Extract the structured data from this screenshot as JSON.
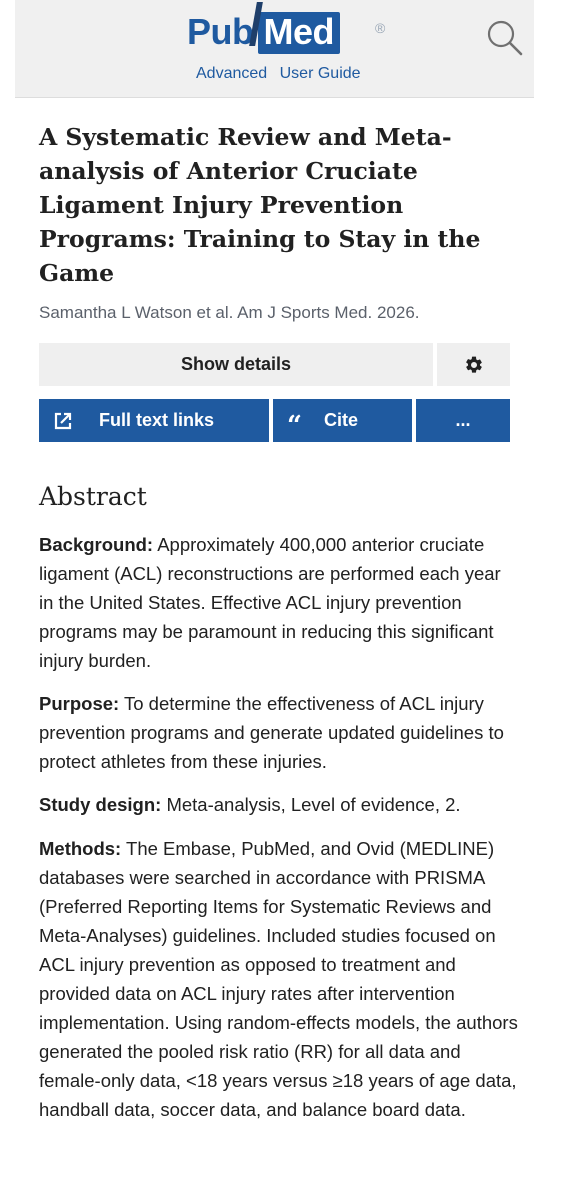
{
  "header": {
    "logo_pub": "Pub",
    "logo_med": "Med",
    "logo_reg": "®",
    "advanced_label": "Advanced",
    "user_guide_label": "User Guide",
    "search_icon": "magnifier-icon"
  },
  "article": {
    "title": "A Systematic Review and Meta-analysis of Anterior Cruciate Ligament Injury Prevention Programs: Training to Stay in the Game",
    "citation": "Samantha L Watson et al. Am J Sports Med. 2026."
  },
  "actions": {
    "show_details": "Show details",
    "full_text_links": "Full text links",
    "cite": "Cite",
    "cite_glyph": "“",
    "more": "...",
    "gear_icon": "gear-icon",
    "external_link_icon": "external-link-icon"
  },
  "abstract": {
    "heading": "Abstract",
    "sections": [
      {
        "label": "Background:",
        "text": "Approximately 400,000 anterior cruciate ligament (ACL) reconstructions are performed each year in the United States. Effective ACL injury prevention programs may be paramount in reducing this significant injury burden."
      },
      {
        "label": "Purpose:",
        "text": "To determine the effectiveness of ACL injury prevention programs and generate updated guidelines to protect athletes from these injuries."
      },
      {
        "label": "Study design:",
        "text": "Meta-analysis, Level of evidence, 2."
      },
      {
        "label": "Methods:",
        "text": "The Embase, PubMed, and Ovid (MEDLINE) databases were searched in accordance with PRISMA (Preferred Reporting Items for Systematic Reviews and Meta-Analyses) guidelines. Included studies focused on ACL injury prevention as opposed to treatment and provided data on ACL injury rates after intervention implementation. Using random-effects models, the authors generated the pooled risk ratio (RR) for all data and female-only data, <18 years versus ≥18 years of age data, handball data, soccer data, and balance board data."
      }
    ]
  },
  "colors": {
    "brand_blue": "#1f5aa0",
    "button_gray": "#efefef",
    "header_bg": "#f0f0f0",
    "citation_gray": "#5b616b"
  }
}
